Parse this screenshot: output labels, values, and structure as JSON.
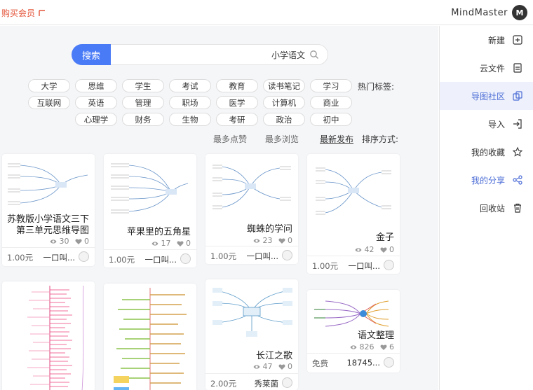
{
  "app": {
    "logo_text": "M",
    "name": "MindMaster",
    "vip_label": "购买会员"
  },
  "sidebar": {
    "items": [
      {
        "label": "新建",
        "icon": "plus-square-icon"
      },
      {
        "label": "云文件",
        "icon": "cloud-file-icon"
      },
      {
        "label": "导图社区",
        "icon": "copy-icon"
      },
      {
        "label": "导入",
        "icon": "import-icon"
      },
      {
        "label": "我的收藏",
        "icon": "star-icon"
      },
      {
        "label": "我的分享",
        "icon": "share-icon"
      },
      {
        "label": "回收站",
        "icon": "trash-icon"
      }
    ],
    "active_index": 2
  },
  "search": {
    "button_label": "搜索",
    "value": "小学语文"
  },
  "tags": {
    "label": "热门标签:",
    "items": [
      "学习",
      "读书笔记",
      "教育",
      "考试",
      "学生",
      "思维",
      "大学",
      "商业",
      "计算机",
      "医学",
      "职场",
      "管理",
      "英语",
      "互联网",
      "初中",
      "政治",
      "考研",
      "生物",
      "财务",
      "心理学"
    ]
  },
  "sort": {
    "label": "排序方式:",
    "options": [
      "最新发布",
      "最多浏览",
      "最多点赞"
    ],
    "active_index": 0
  },
  "cards": [
    {
      "title": "金子",
      "views": "42",
      "likes": "0",
      "author": "一口叫...",
      "price": "1.00元"
    },
    {
      "title": "蜘蛛的学问",
      "views": "23",
      "likes": "0",
      "author": "一口叫...",
      "price": "1.00元"
    },
    {
      "title": "苹果里的五角星",
      "views": "17",
      "likes": "0",
      "author": "一口叫...",
      "price": "1.00元"
    },
    {
      "title": "苏教版小学语文三下第三单元思维导图",
      "views": "30",
      "likes": "0",
      "author": "一口叫...",
      "price": "1.00元"
    },
    {
      "title": "语文整理",
      "views": "826",
      "likes": "6",
      "author": "18745...",
      "price": "免费"
    },
    {
      "title": "长江之歌",
      "views": "47",
      "likes": "0",
      "author": "秀莱菌",
      "price": "2.00元"
    }
  ],
  "colors": {
    "accent": "#4a7bf7",
    "active_nav_bg": "#eef1fb",
    "active_nav_text": "#4a6bd6",
    "vip": "#e4553a"
  }
}
